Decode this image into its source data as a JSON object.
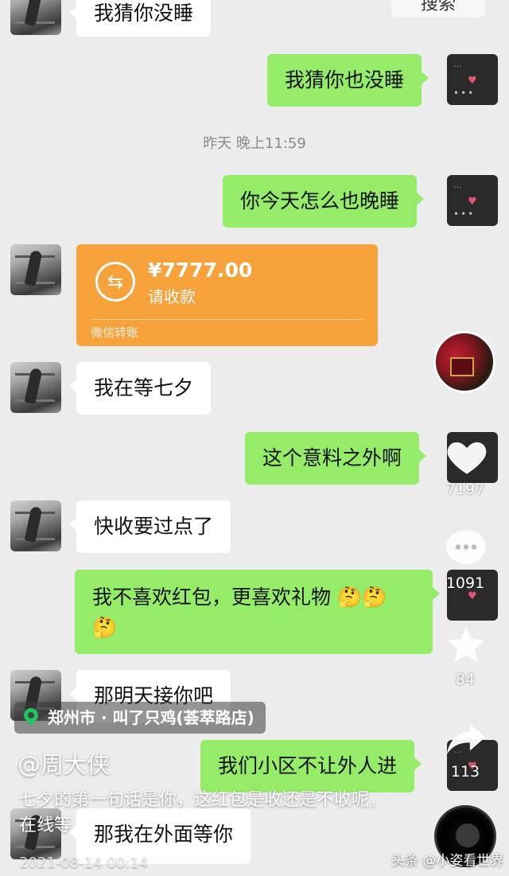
{
  "chat": {
    "top_right_partial": "搜索",
    "messages": [
      {
        "id": "m1",
        "side": "in",
        "text": "我猜你没睡"
      },
      {
        "id": "m2",
        "side": "out",
        "text": "我猜你也没睡"
      },
      {
        "id": "m3",
        "side": "out",
        "text": "你今天怎么也晚睡"
      },
      {
        "id": "m5",
        "side": "in",
        "text": "我在等七夕"
      },
      {
        "id": "m6",
        "side": "out",
        "text": "这个意料之外啊"
      },
      {
        "id": "m7",
        "side": "in",
        "text": "快收要过点了"
      },
      {
        "id": "m8",
        "side": "out",
        "text": "我不喜欢红包，更喜欢礼物"
      },
      {
        "id": "m9",
        "side": "in",
        "text": "那明天接你吧"
      },
      {
        "id": "m10",
        "side": "out",
        "text": "我们小区不让外人进"
      },
      {
        "id": "m11",
        "side": "in",
        "text": "那我在外面等你"
      }
    ],
    "timestamp": "昨天 晚上11:59",
    "transfer": {
      "amount": "¥7777.00",
      "description": "请收款",
      "footer": "微信转账",
      "color": "#f7a23a"
    },
    "colors": {
      "outgoing": "#95ec69",
      "incoming": "#ffffff",
      "background": "#ececec"
    }
  },
  "video_overlay": {
    "likes": "7197",
    "comments": "1091",
    "favorites": "84",
    "shares": "113",
    "location": "郑州市 · 叫了只鸡(荟萃路店)",
    "author": "@周大侠",
    "caption": "七夕的第一句话是你，这红包是收还是不收呢，在线等",
    "date": "2021-08-14 00:14",
    "watermark": "头条 @小姿看世界"
  }
}
